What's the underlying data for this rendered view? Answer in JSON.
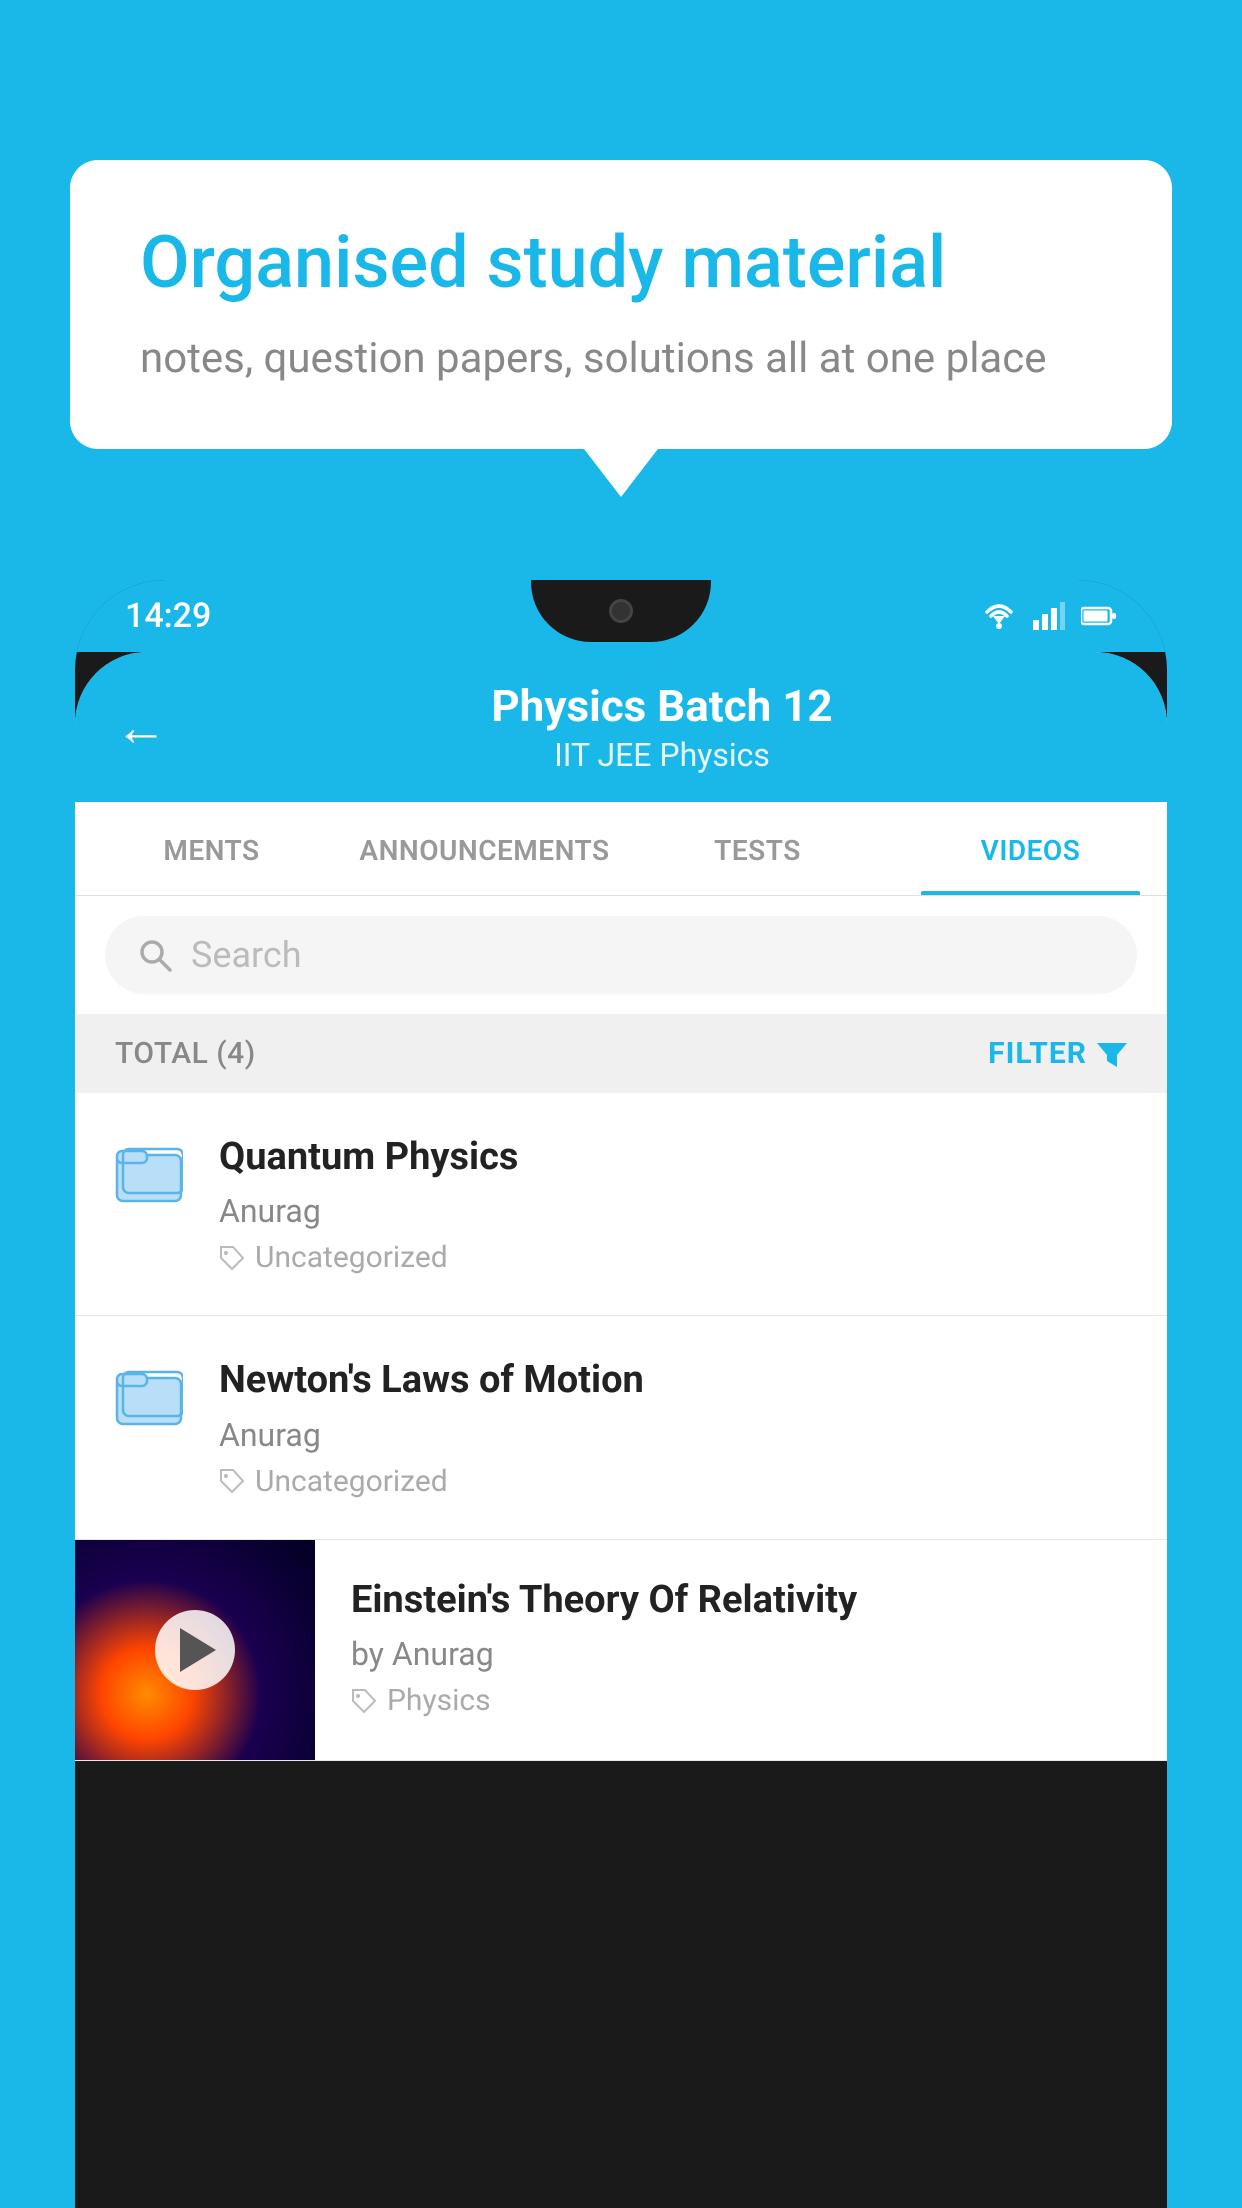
{
  "background_color": "#1ab8e8",
  "speech_bubble": {
    "title": "Organised study material",
    "subtitle": "notes, question papers, solutions all at one place"
  },
  "status_bar": {
    "time": "14:29"
  },
  "app_header": {
    "back_label": "←",
    "title": "Physics Batch 12",
    "subtitle": "IIT JEE   Physics"
  },
  "tabs": [
    {
      "label": "MENTS",
      "active": false
    },
    {
      "label": "ANNOUNCEMENTS",
      "active": false
    },
    {
      "label": "TESTS",
      "active": false
    },
    {
      "label": "VIDEOS",
      "active": true
    }
  ],
  "search": {
    "placeholder": "Search"
  },
  "filter_bar": {
    "total_label": "TOTAL (4)",
    "filter_label": "FILTER"
  },
  "list_items": [
    {
      "title": "Quantum Physics",
      "author": "Anurag",
      "tag": "Uncategorized",
      "type": "folder"
    },
    {
      "title": "Newton's Laws of Motion",
      "author": "Anurag",
      "tag": "Uncategorized",
      "type": "folder"
    },
    {
      "title": "Einstein's Theory Of Relativity",
      "author": "by Anurag",
      "tag": "Physics",
      "type": "video"
    }
  ]
}
